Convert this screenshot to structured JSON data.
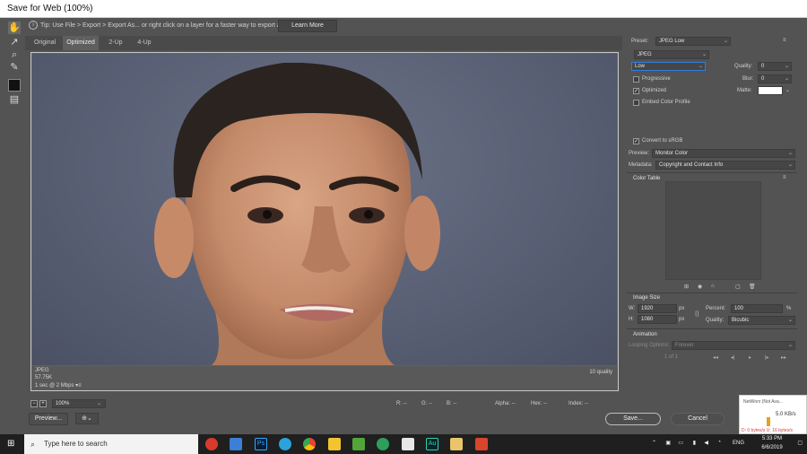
{
  "window": {
    "title": "Save for Web (100%)"
  },
  "tip": {
    "text": "Tip: Use File > Export > Export As... or right click on a layer for a faster way to export assets",
    "learn_more": "Learn More"
  },
  "tabs": [
    "Original",
    "Optimized",
    "2-Up",
    "4-Up"
  ],
  "image_info": {
    "format": "JPEG",
    "size": "57.75K",
    "speed": "1 sec @ 2 Mbps",
    "quality": "10 quality"
  },
  "bottom": {
    "zoom": "100%",
    "r": "R: --",
    "g": "G: --",
    "b": "B: --",
    "alpha": "Alpha: --",
    "hex": "Hex: --",
    "index": "Index: --",
    "preview": "Preview..."
  },
  "settings": {
    "preset_label": "Preset:",
    "preset_value": "JPEG Low",
    "format_value": "JPEG",
    "quality_level": "Low",
    "quality_label": "Quality:",
    "quality_value": "0",
    "blur_label": "Blur:",
    "blur_value": "0",
    "matte_label": "Matte:",
    "progressive": "Progressive",
    "optimized": "Optimized",
    "embed_profile": "Embed Color Profile",
    "convert_srgb": "Convert to sRGB",
    "preview_label": "Preview:",
    "preview_value": "Monitor Color",
    "metadata_label": "Metadata:",
    "metadata_value": "Copyright and Contact Info",
    "color_table": "Color Table"
  },
  "image_size": {
    "heading": "Image Size",
    "w_label": "W:",
    "w_value": "1920",
    "h_label": "H:",
    "h_value": "1080",
    "unit": "px",
    "percent_label": "Percent:",
    "percent_value": "100",
    "percent_unit": "%",
    "quality_label": "Quality:",
    "quality_value": "Bicubic"
  },
  "animation": {
    "heading": "Animation",
    "looping_label": "Looping Options:",
    "looping_value": "Forever",
    "frame": "1 of 1"
  },
  "buttons": {
    "save": "Save...",
    "cancel": "Cancel"
  },
  "taskbar": {
    "search_placeholder": "Type here to search",
    "time": "5:33 PM",
    "date": "6/6/2019",
    "lang": "ENG"
  },
  "network": {
    "title": "NetWorx (Not Ava...",
    "rate": "5.0 KB/s",
    "stats": "D: 0 bytes/s U: 16 bytes/s"
  },
  "colors": {
    "accent": "#2d7ee0",
    "dialog_bg": "#535353",
    "taskbar": "#1f1f1f"
  }
}
